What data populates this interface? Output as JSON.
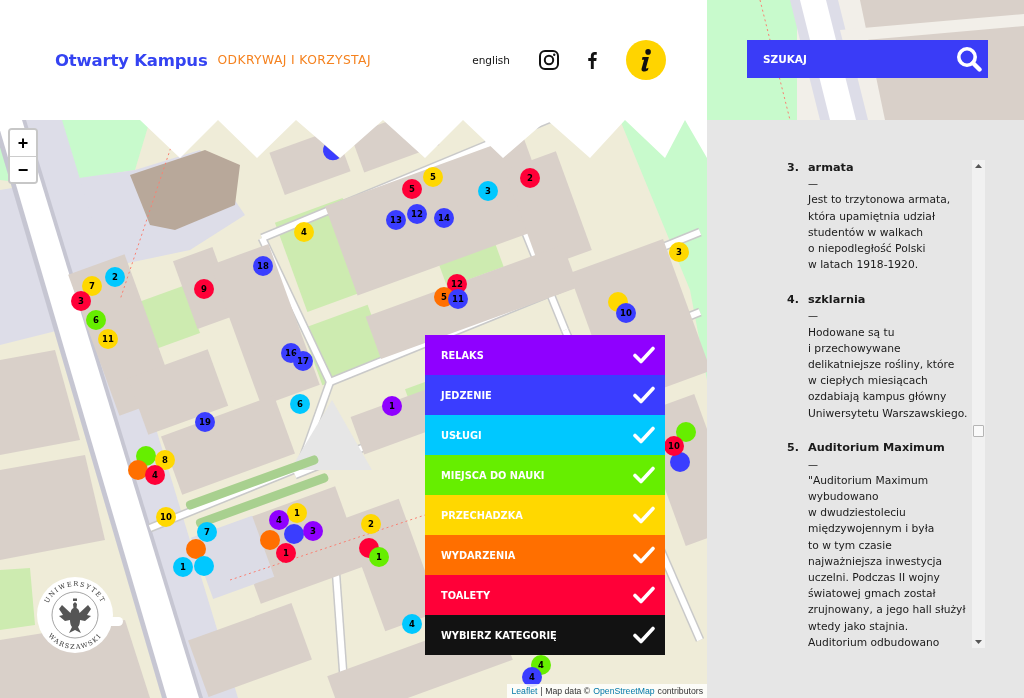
{
  "header": {
    "title": "Otwarty Kampus",
    "tagline": "ODKRYWAJ I KORZYSTAJ",
    "language": "english"
  },
  "search": {
    "placeholder": "SZUKAJ"
  },
  "map": {
    "zoom_controls": [
      "+",
      "−"
    ],
    "markers": [
      {
        "color": "#3a3dff"
      },
      {
        "label": "4",
        "color": "#ffd800"
      },
      {
        "label": "18",
        "color": "#3a3dff"
      },
      {
        "label": "2",
        "color": "#00c8ff"
      },
      {
        "label": "7",
        "color": "#ffd800"
      },
      {
        "label": "3",
        "color": "#ff0038"
      },
      {
        "label": "9",
        "color": "#ff0038"
      },
      {
        "label": "6",
        "color": "#66ee00"
      },
      {
        "label": "11",
        "color": "#ffd800"
      },
      {
        "label": "16",
        "color": "#3a3dff"
      },
      {
        "label": "17",
        "color": "#3a3dff"
      },
      {
        "label": "6",
        "color": "#00c8ff"
      },
      {
        "label": "19",
        "color": "#3a3dff"
      },
      {
        "label": "5",
        "color": "#ffd800"
      },
      {
        "label": "5",
        "color": "#ff0038"
      },
      {
        "label": "3",
        "color": "#00c8ff"
      },
      {
        "label": "2",
        "color": "#ff0038"
      },
      {
        "label": "13",
        "color": "#3a3dff"
      },
      {
        "label": "12",
        "color": "#3a3dff"
      },
      {
        "label": "14",
        "color": "#3a3dff"
      },
      {
        "label": "3",
        "color": "#ffd800"
      },
      {
        "label": "12",
        "color": "#ff0038"
      },
      {
        "label": "5",
        "color": "#ff6f00"
      },
      {
        "label": "11",
        "color": "#3a3dff"
      },
      {
        "color": "#ffd800"
      },
      {
        "label": "10",
        "color": "#3a3dff"
      },
      {
        "label": "1",
        "color": "#8f00ff"
      },
      {
        "color": "#66ee00"
      },
      {
        "label": "8",
        "color": "#ffd800"
      },
      {
        "color": "#ff6f00"
      },
      {
        "label": "4",
        "color": "#ff0038"
      },
      {
        "label": "10",
        "color": "#ffd800"
      },
      {
        "color": "#ff6f00"
      },
      {
        "label": "7",
        "color": "#00c8ff"
      },
      {
        "color": "#00c8ff"
      },
      {
        "label": "1",
        "color": "#00c8ff"
      },
      {
        "label": "1",
        "color": "#ffd800"
      },
      {
        "color": "#3a3dff"
      },
      {
        "label": "4",
        "color": "#8f00ff"
      },
      {
        "color": "#ff6f00"
      },
      {
        "label": "1",
        "color": "#ff0038"
      },
      {
        "label": "3",
        "color": "#8f00ff"
      },
      {
        "label": "2",
        "color": "#ffd800"
      },
      {
        "color": "#ff0038"
      },
      {
        "label": "1",
        "color": "#66ee00"
      },
      {
        "label": "4",
        "color": "#00c8ff"
      },
      {
        "color": "#66ee00"
      },
      {
        "color": "#3a3dff"
      },
      {
        "label": "10",
        "color": "#ff0038"
      },
      {
        "label": "4",
        "color": "#66ee00"
      },
      {
        "label": "4",
        "color": "#3a3dff"
      }
    ],
    "logo": {
      "top_text": "UNIWERSYTET",
      "bottom_text": "WARSZAWSKI"
    },
    "attribution": [
      {
        "kind": "link",
        "text": "Leaflet"
      },
      {
        "kind": "text",
        "text": "| Map data ©"
      },
      {
        "kind": "link",
        "text": "OpenStreetMap"
      },
      {
        "kind": "text",
        "text": "contributors"
      }
    ]
  },
  "categories": [
    {
      "label": "RELAKS",
      "color": "#8f00ff",
      "checked": true
    },
    {
      "label": "JEDZENIE",
      "color": "#3a3dff",
      "checked": true
    },
    {
      "label": "USŁUGI",
      "color": "#00c8ff",
      "checked": true
    },
    {
      "label": "MIEJSCA DO NAUKI",
      "color": "#66ee00",
      "checked": true
    },
    {
      "label": "PRZECHADZKA",
      "color": "#ffd800",
      "checked": true
    },
    {
      "label": "WYDARZENIA",
      "color": "#ff6f00",
      "checked": true
    },
    {
      "label": "TOALETY",
      "color": "#ff0038",
      "checked": true
    },
    {
      "label": "WYBIERZ KATEGORIĘ",
      "color": "#121212",
      "checked": true
    }
  ],
  "panel": {
    "items": [
      {
        "number": "3.",
        "title": "armata",
        "dash": "—",
        "description": "Jest to trzytonowa armata,\nktóra upamiętnia udział\nstudentów w walkach\no niepodległość Polski\nw latach 1918-1920."
      },
      {
        "number": "4.",
        "title": "szklarnia",
        "dash": "—",
        "description": "Hodowane są tu\ni przechowywane\ndelikatniejsze rośliny, które\nw ciepłych miesiącach\nozdabiają kampus główny\nUniwersytetu Warszawskiego."
      },
      {
        "number": "5.",
        "title": "Auditorium Maximum",
        "dash": "—",
        "description": "\"Auditorium Maximum\nwybudowano\nw dwudziestoleciu\nmiędzywojennym i była\nto w tym czasie\nnajważniejsza inwestycja\nuczelni. Podczas II wojny\nświatowej gmach został\nzrujnowany, a jego hall służył\nwtedy jako stajnia.\nAuditorium odbudowano"
      }
    ]
  }
}
